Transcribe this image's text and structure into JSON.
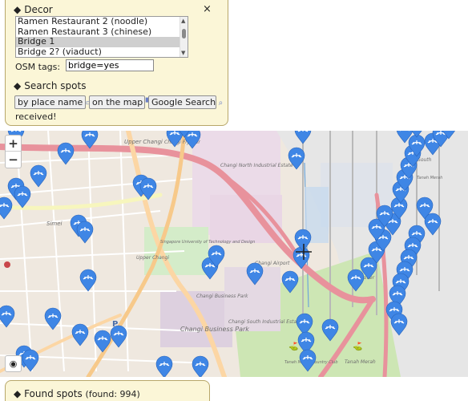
{
  "decor": {
    "title": "Decor",
    "close": "×",
    "list_items": [
      {
        "label": "Ramen Restaurant 2 (noodle)",
        "selected": false
      },
      {
        "label": "Ramen Restaurant 3 (chinese)",
        "selected": false
      },
      {
        "label": "Bridge 1",
        "selected": true
      },
      {
        "label": "Bridge 2? (viaduct)",
        "selected": false
      }
    ],
    "osm_label": "OSM tags:",
    "osm_value": "bridge=yes"
  },
  "search": {
    "title": "Search spots",
    "by_place_label": "by place name",
    "on_map_label": "on the map",
    "google_label": "Google Search",
    "status": "received!"
  },
  "map": {
    "zoom_in": "+",
    "zoom_out": "−",
    "locate": "◉",
    "labels": [
      "Upper Changi",
      "Changi Flyover",
      "Changi North Industrial Estate",
      "Simei",
      "Singapore University of Technology and Design",
      "Upper Changi",
      "Changi Airport",
      "Changi Business Park",
      "Changi Business Park",
      "Changi South Industrial Estate",
      "Tanah Merah Country Club",
      "Tanah Merah",
      "A South",
      "Flyover",
      "Tanah Merah"
    ],
    "marker_color": "#3f86e5"
  },
  "found": {
    "title": "Found spots",
    "count": "(found: 994)"
  }
}
